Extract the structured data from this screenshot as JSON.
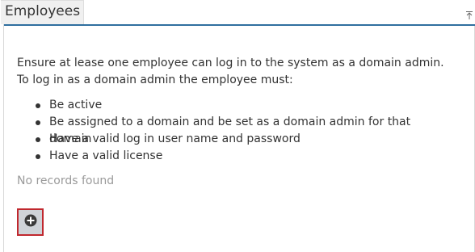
{
  "panel": {
    "title": "Employees",
    "collapse_icon": "collapse-up-icon"
  },
  "content": {
    "intro": "Ensure at lease one employee can log in to the system as a domain admin. To log in as a domain admin the employee must:",
    "requirements": [
      "Be active",
      "Be assigned to a domain and be set as a domain admin for that domain",
      "Have a valid log in user name and password",
      "Have a valid license"
    ],
    "empty_state": "No records found"
  },
  "add_button": {
    "icon": "plus-circle-icon",
    "accent_color": "#c0282e",
    "fill_color": "#cfd3d8"
  },
  "colors": {
    "header_rule": "#2f6f9f",
    "text": "#333333",
    "muted": "#9a9a9a"
  }
}
